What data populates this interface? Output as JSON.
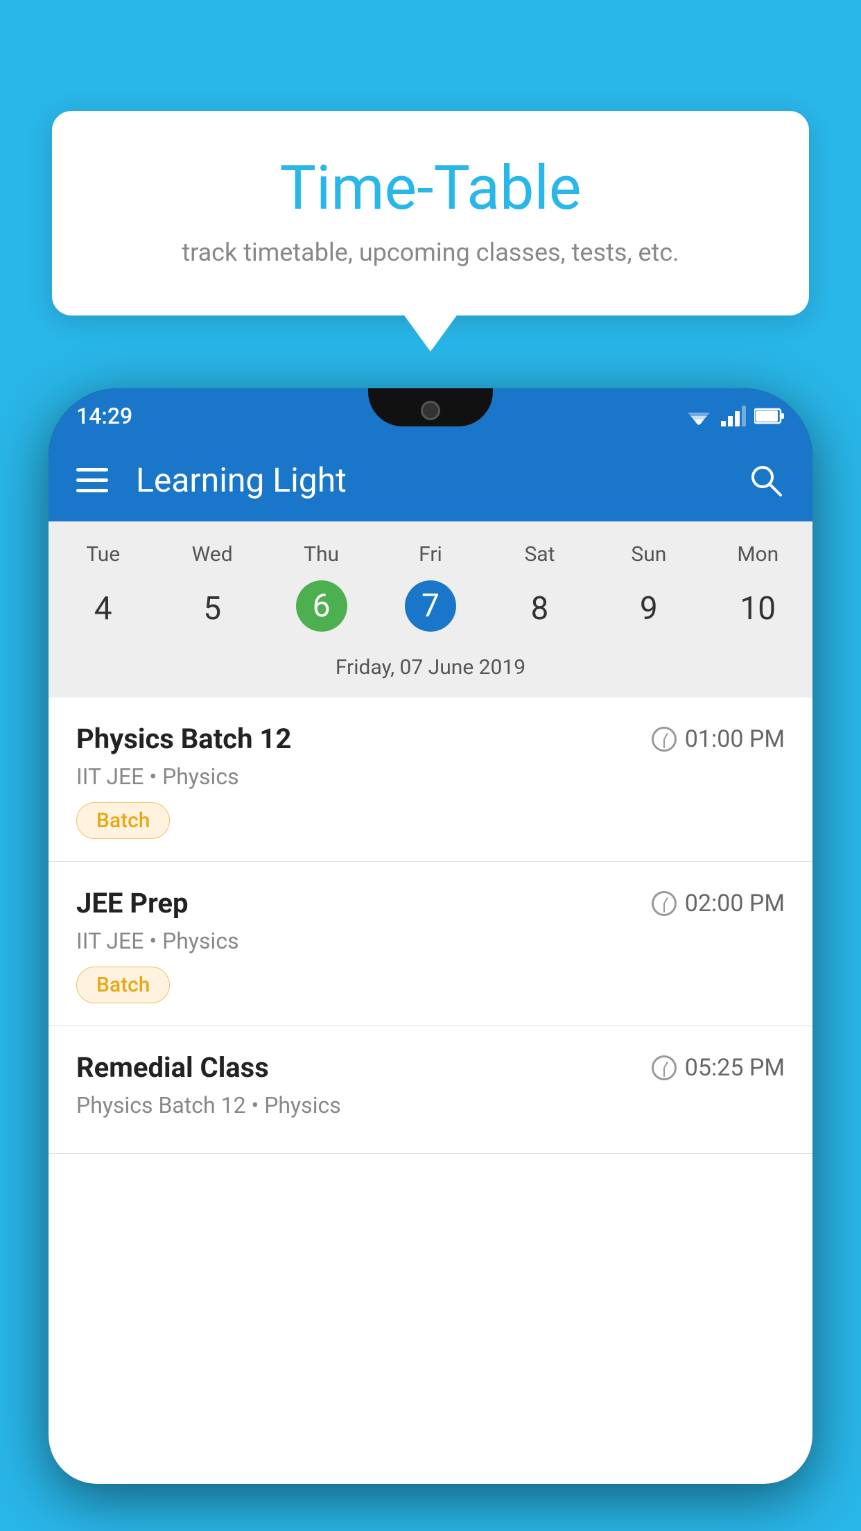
{
  "page": {
    "background_color": "#29b6e8"
  },
  "tooltip": {
    "title": "Time-Table",
    "subtitle": "track timetable, upcoming classes, tests, etc."
  },
  "status_bar": {
    "time": "14:29"
  },
  "app_bar": {
    "title": "Learning Light"
  },
  "calendar": {
    "days": [
      "Tue",
      "Wed",
      "Thu",
      "Fri",
      "Sat",
      "Sun",
      "Mon"
    ],
    "dates": [
      "4",
      "5",
      "6",
      "7",
      "8",
      "9",
      "10"
    ],
    "today_index": 2,
    "selected_index": 3,
    "selected_date_label": "Friday, 07 June 2019"
  },
  "classes": [
    {
      "name": "Physics Batch 12",
      "time": "01:00 PM",
      "info": "IIT JEE • Physics",
      "tag": "Batch"
    },
    {
      "name": "JEE Prep",
      "time": "02:00 PM",
      "info": "IIT JEE • Physics",
      "tag": "Batch"
    },
    {
      "name": "Remedial Class",
      "time": "05:25 PM",
      "info": "Physics Batch 12 • Physics",
      "tag": ""
    }
  ]
}
